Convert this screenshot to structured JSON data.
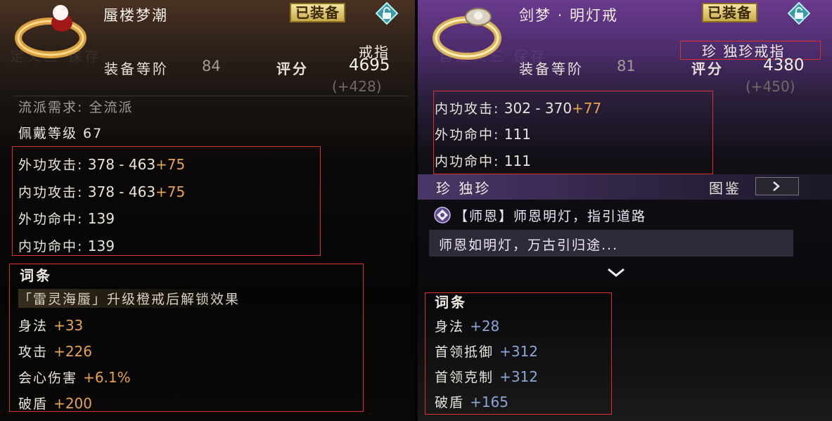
{
  "left": {
    "title": "蜃楼梦潮",
    "equipped": "已装备",
    "watermark": "定义三 保存",
    "item_type": "戒指",
    "tier_label": "装备等阶",
    "tier_value": "84",
    "score_label": "评分",
    "score_value": "4695",
    "score_delta": "(+428)",
    "school_req": "流派需求: 全流派",
    "wear_level": "佩戴等级 67",
    "stats": [
      {
        "label": "外功攻击:",
        "value": " 378 - 463",
        "bonus": "+75"
      },
      {
        "label": "内功攻击:",
        "value": " 378 - 463",
        "bonus": "+75"
      },
      {
        "label": "外功命中:",
        "value": " 139",
        "bonus": ""
      },
      {
        "label": "内功命中:",
        "value": " 139",
        "bonus": ""
      }
    ],
    "affix_header": "词条",
    "affix_note": "「雷灵海蜃」升级橙戒后解锁效果",
    "affixes": [
      {
        "label": "身法",
        "value": "+33"
      },
      {
        "label": "攻击",
        "value": "+226"
      },
      {
        "label": "会心伤害",
        "value": "+6.1%"
      },
      {
        "label": "破盾",
        "value": "+200"
      }
    ]
  },
  "right": {
    "title": "剑梦 · 明灯戒",
    "equipped": "已装备",
    "watermark": "自定义三 保存",
    "item_type": "珍 独珍戒指",
    "tier_label": "装备等阶",
    "tier_value": "81",
    "score_label": "评分",
    "score_value": "4380",
    "score_delta": "(+450)",
    "stats": [
      {
        "label": "内功攻击:",
        "value": " 302 - 370",
        "bonus": "+77"
      },
      {
        "label": "外功命中:",
        "value": " 111",
        "bonus": ""
      },
      {
        "label": "内功命中:",
        "value": " 111",
        "bonus": ""
      }
    ],
    "unique_label": "珍 独珍",
    "codex_label": "图鉴",
    "codex_button": "›",
    "skill_title": "【师恩】师恩明灯，指引道路",
    "skill_desc": "师恩如明灯，万古引归途...",
    "affix_header": "词条",
    "affixes": [
      {
        "label": "身法",
        "value": "+28"
      },
      {
        "label": "首领抵御",
        "value": "+312"
      },
      {
        "label": "首领克制",
        "value": "+312"
      },
      {
        "label": "破盾",
        "value": "+165"
      }
    ]
  },
  "colors": {
    "bonus_orange": "#e7a253",
    "affix_blue": "#8aa6d6",
    "highlight_red": "#d8302c",
    "badge_gold": "#e2cc72"
  },
  "icons": [
    "ring-icon",
    "lock-icon",
    "skill-gem-icon",
    "chevron-down-icon",
    "arrow-right-icon"
  ]
}
